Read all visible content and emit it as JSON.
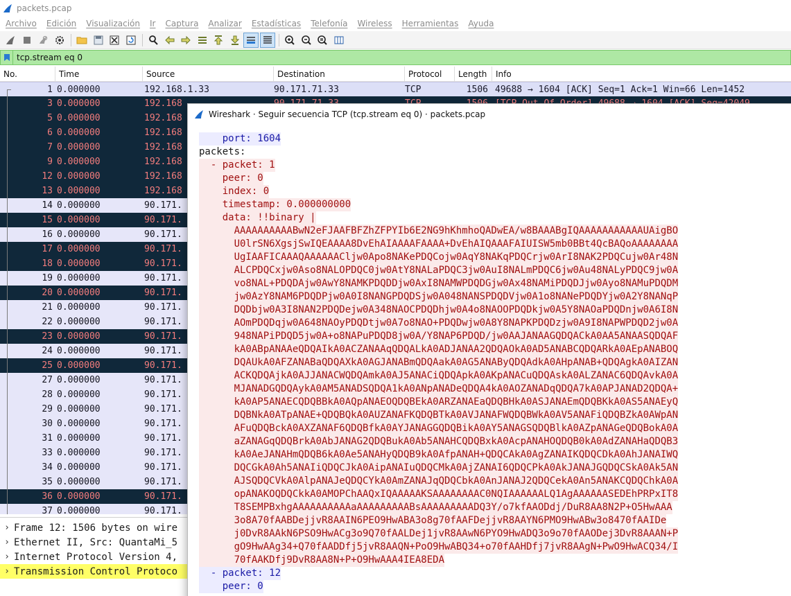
{
  "window": {
    "title": "packets.pcap"
  },
  "menu": [
    "Archivo",
    "Edición",
    "Visualización",
    "Ir",
    "Captura",
    "Analizar",
    "Estadísticas",
    "Telefonía",
    "Wireless",
    "Herramientas",
    "Ayuda"
  ],
  "toolbar": {
    "icons": [
      "shark-fin-start-icon",
      "stop-icon",
      "restart-icon",
      "options-gear-icon",
      "open-folder-icon",
      "save-file-icon",
      "close-file-icon",
      "reload-icon",
      "find-icon",
      "back-arrow-icon",
      "forward-arrow-icon",
      "go-to-packet-icon",
      "first-packet-icon",
      "last-packet-icon",
      "autoscroll-icon",
      "colorize-icon",
      "zoom-in-icon",
      "zoom-out-icon",
      "zoom-normal-icon",
      "resize-columns-icon"
    ]
  },
  "filter": {
    "value": "tcp.stream eq 0",
    "bg_color": "#aee8a4"
  },
  "packet_list": {
    "columns": [
      "No.",
      "Time",
      "Source",
      "Destination",
      "Protocol",
      "Length",
      "Info"
    ],
    "rows": [
      {
        "no": "1",
        "time": "0.000000",
        "src": "192.168.1.33",
        "dst": "90.171.71.33",
        "proto": "TCP",
        "len": "1506",
        "info": "49688 → 1604 [ACK] Seq=1 Ack=1 Win=66 Len=1452",
        "style": "selected"
      },
      {
        "no": "3",
        "time": "0.000000",
        "src": "192.168",
        "dst": "90.171.71.33",
        "proto": "TCP",
        "len": "1506",
        "info": "[TCP Out-Of-Order] 49688 → 1604 [ACK] Seq=42049",
        "style": "dark"
      },
      {
        "no": "5",
        "time": "0.000000",
        "src": "192.168",
        "dst": "",
        "proto": "",
        "len": "",
        "info": "",
        "style": "dark"
      },
      {
        "no": "6",
        "time": "0.000000",
        "src": "192.168",
        "dst": "",
        "proto": "",
        "len": "",
        "info": "",
        "style": "dark"
      },
      {
        "no": "7",
        "time": "0.000000",
        "src": "192.168",
        "dst": "",
        "proto": "",
        "len": "",
        "info": "",
        "style": "dark"
      },
      {
        "no": "9",
        "time": "0.000000",
        "src": "192.168",
        "dst": "",
        "proto": "",
        "len": "",
        "info": "",
        "style": "dark"
      },
      {
        "no": "12",
        "time": "0.000000",
        "src": "192.168",
        "dst": "",
        "proto": "",
        "len": "",
        "info": "",
        "style": "dark"
      },
      {
        "no": "13",
        "time": "0.000000",
        "src": "192.168",
        "dst": "",
        "proto": "",
        "len": "",
        "info": "",
        "style": "dark"
      },
      {
        "no": "14",
        "time": "0.000000",
        "src": "90.171.",
        "dst": "",
        "proto": "",
        "len": "",
        "info": "",
        "style": "light"
      },
      {
        "no": "15",
        "time": "0.000000",
        "src": "90.171.",
        "dst": "",
        "proto": "",
        "len": "",
        "info": "",
        "style": "dark"
      },
      {
        "no": "16",
        "time": "0.000000",
        "src": "90.171.",
        "dst": "",
        "proto": "",
        "len": "",
        "info": "",
        "style": "light"
      },
      {
        "no": "17",
        "time": "0.000000",
        "src": "90.171.",
        "dst": "",
        "proto": "",
        "len": "",
        "info": "",
        "style": "dark"
      },
      {
        "no": "18",
        "time": "0.000000",
        "src": "90.171.",
        "dst": "",
        "proto": "",
        "len": "",
        "info": "",
        "style": "dark"
      },
      {
        "no": "19",
        "time": "0.000000",
        "src": "90.171.",
        "dst": "",
        "proto": "",
        "len": "",
        "info": "",
        "style": "light"
      },
      {
        "no": "20",
        "time": "0.000000",
        "src": "90.171.",
        "dst": "",
        "proto": "",
        "len": "",
        "info": "",
        "style": "dark"
      },
      {
        "no": "21",
        "time": "0.000000",
        "src": "90.171.",
        "dst": "",
        "proto": "",
        "len": "",
        "info": "",
        "style": "light"
      },
      {
        "no": "22",
        "time": "0.000000",
        "src": "90.171.",
        "dst": "",
        "proto": "",
        "len": "",
        "info": "",
        "style": "light"
      },
      {
        "no": "23",
        "time": "0.000000",
        "src": "90.171.",
        "dst": "",
        "proto": "",
        "len": "",
        "info": "",
        "style": "dark"
      },
      {
        "no": "24",
        "time": "0.000000",
        "src": "90.171.",
        "dst": "",
        "proto": "",
        "len": "",
        "info": "",
        "style": "light"
      },
      {
        "no": "25",
        "time": "0.000000",
        "src": "90.171.",
        "dst": "",
        "proto": "",
        "len": "",
        "info": "",
        "style": "dark"
      },
      {
        "no": "27",
        "time": "0.000000",
        "src": "90.171.",
        "dst": "",
        "proto": "",
        "len": "",
        "info": "",
        "style": "light"
      },
      {
        "no": "28",
        "time": "0.000000",
        "src": "90.171.",
        "dst": "",
        "proto": "",
        "len": "",
        "info": "",
        "style": "light"
      },
      {
        "no": "29",
        "time": "0.000000",
        "src": "90.171.",
        "dst": "",
        "proto": "",
        "len": "",
        "info": "",
        "style": "light"
      },
      {
        "no": "30",
        "time": "0.000000",
        "src": "90.171.",
        "dst": "",
        "proto": "",
        "len": "",
        "info": "",
        "style": "light"
      },
      {
        "no": "31",
        "time": "0.000000",
        "src": "90.171.",
        "dst": "",
        "proto": "",
        "len": "",
        "info": "",
        "style": "light"
      },
      {
        "no": "33",
        "time": "0.000000",
        "src": "90.171.",
        "dst": "",
        "proto": "",
        "len": "",
        "info": "",
        "style": "light"
      },
      {
        "no": "34",
        "time": "0.000000",
        "src": "90.171.",
        "dst": "",
        "proto": "",
        "len": "",
        "info": "",
        "style": "light"
      },
      {
        "no": "35",
        "time": "0.000000",
        "src": "90.171.",
        "dst": "",
        "proto": "",
        "len": "",
        "info": "",
        "style": "light"
      },
      {
        "no": "36",
        "time": "0.000000",
        "src": "90.171.",
        "dst": "",
        "proto": "",
        "len": "",
        "info": "",
        "style": "dark"
      },
      {
        "no": "37",
        "time": "0.000000",
        "src": "90.171.",
        "dst": "",
        "proto": "",
        "len": "",
        "info": "",
        "style": "light"
      }
    ],
    "colors": {
      "light": "#e6e6f9",
      "dark": "#10283a",
      "dark_text": "#f47d7d"
    }
  },
  "details": [
    {
      "text": "Frame 12: 1506 bytes on wire",
      "highlight": false
    },
    {
      "text": "Ethernet II, Src: QuantaMi_5",
      "highlight": false
    },
    {
      "text": "Internet Protocol Version 4,",
      "highlight": false
    },
    {
      "text": "Transmission Control Protoco",
      "highlight": true
    }
  ],
  "dialog": {
    "title": "Wireshark · Seguir secuencia TCP (tcp.stream eq 0) · packets.pcap",
    "lines": [
      {
        "text": "    port: 1604",
        "kind": "b"
      },
      {
        "text": "packets:",
        "kind": "p"
      },
      {
        "text": "  - packet: 1",
        "kind": "r"
      },
      {
        "text": "    peer: 0",
        "kind": "r"
      },
      {
        "text": "    index: 0",
        "kind": "r"
      },
      {
        "text": "    timestamp: 0.000000000",
        "kind": "r"
      },
      {
        "text": "    data: !!binary |",
        "kind": "r"
      },
      {
        "text": "      AAAAAAAAAABwN2eFJAAFBFZhZFPYIb6E2NG9hKhmhoQADwEA/w8BAAABgIQAAAAAAAAAAAUAigBO",
        "kind": "r"
      },
      {
        "text": "      U0lrSN6XgsjSwIQEAAAA8DvEhAIAAAAFAAAA+DvEhAIQAAAFAIUISW5mb0BBt4QcBAQoAAAAAAAA",
        "kind": "r"
      },
      {
        "text": "      UgIAAFICAAAQAAAAAACljw0Apo8NAKePDQCojw0AqY8NAKqPDQCrjw0ArI8NAK2PDQCujw0Ar48N",
        "kind": "r"
      },
      {
        "text": "      ALCPDQCxjw0Aso8NALOPDQC0jw0AtY8NALaPDQC3jw0AuI8NALmPDQC6jw0Au48NALyPDQC9jw0A",
        "kind": "r"
      },
      {
        "text": "      vo8NAL+PDQDAjw0AwY8NAMKPDQDDjw0AxI8NAMWPDQDGjw0Ax48NAMiPDQDJjw0Ayo8NAMuPDQDM",
        "kind": "r"
      },
      {
        "text": "      jw0AzY8NAM6PDQDPjw0A0I8NANGPDQDSjw0A048NANSPDQDVjw0A1o8NANePDQDYjw0A2Y8NANqP",
        "kind": "r"
      },
      {
        "text": "      DQDbjw0A3I8NAN2PDQDejw0A348NAOCPDQDhjw0A4o8NAOOPDQDkjw0A5Y8NAOaPDQDnjw0A6I8N",
        "kind": "r"
      },
      {
        "text": "      AOmPDQDqjw0A648NAOyPDQDtjw0A7o8NAO+PDQDwjw0A8Y8NAPKPDQDzjw0A9I8NAPWPDQD2jw0A",
        "kind": "r"
      },
      {
        "text": "      948NAPiPDQD5jw0A+o8NAPuPDQD8jw0A/Y8NAP6PDQD/jw0AAJANAAGQDQACkA0AA5ANAASQDQAF",
        "kind": "r"
      },
      {
        "text": "      kA0ABpANAAeQDQAIkA0ACZANAAqQDQALkA0ADJANAA2QDQAOkA0AD5ANABCQDQARkA0AEpANABOQ",
        "kind": "r"
      },
      {
        "text": "      DQAUkA0AFZANABaQDQAXkA0AGJANABmQDQAakA0AG5ANAByQDQAdkA0AHpANAB+QDQAgkA0AIZAN",
        "kind": "r"
      },
      {
        "text": "      ACKQDQAjkA0AJJANACWQDQAmkA0AJ5ANACiQDQApkA0AKpANACuQDQAskA0ALZANAC6QDQAvkA0A",
        "kind": "r"
      },
      {
        "text": "      MJANADGQDQAykA0AM5ANADSQDQA1kA0ANpANADeQDQA4kA0AOZANADqQDQA7kA0APJANAD2QDQA+",
        "kind": "r"
      },
      {
        "text": "      kA0AP5ANAECQDQBBkA0AQpANAEOQDQBEkA0ARZANAEaQDQBHkA0ASJANAEmQDQBKkA0AS5ANAEyQ",
        "kind": "r"
      },
      {
        "text": "      DQBNkA0ATpANAE+QDQBQkA0AUZANAFKQDQBTkA0AVJANAFWQDQBWkA0AV5ANAFiQDQBZkA0AWpAN",
        "kind": "r"
      },
      {
        "text": "      AFuQDQBckA0AXZANAF6QDQBfkA0AYJANAGGQDQBikA0AY5ANAGSQDQBlkA0AZpANAGeQDQBokA0A",
        "kind": "r"
      },
      {
        "text": "      aZANAGqQDQBrkA0AbJANAG2QDQBukA0Ab5ANAHCQDQBxkA0AcpANAHOQDQB0kA0AdZANAHaQDQB3",
        "kind": "r"
      },
      {
        "text": "      kA0AeJANAHmQDQB6kA0Ae5ANAHyQDQB9kA0AfpANAH+QDQCAkA0AgZANAIKQDQCDkA0AhJANAIWQ",
        "kind": "r"
      },
      {
        "text": "      DQCGkA0Ah5ANAIiQDQCJkA0AipANAIuQDQCMkA0AjZANAI6QDQCPkA0AkJANAJGQDQCSkA0Ak5AN",
        "kind": "r"
      },
      {
        "text": "      AJSQDQCVkA0AlpANAJeQDQCYkA0AmZANAJqQDQCbkA0AnJANAJ2QDQCekA0An5ANAKCQDQChkA0A",
        "kind": "r"
      },
      {
        "text": "      opANAKOQDQCkkA0AMOPChAAQxIQAAAAAKSAAAAAAAAC0NQIAAAAAALQ1AgAAAAAASEDEhPRPxIT8",
        "kind": "r"
      },
      {
        "text": "      T8SEMPBxhgAAAAAAAAAAaAAAAAAAAABsAAAAAAAAADQ3Y/o7kfAAODdj/DuR8AA8N2P+O5HwAAA",
        "kind": "r"
      },
      {
        "text": "      3o8A70fAABDejjvR8AAIN6PEO9HwABA3o8g70fAAFDejjvR8AAYN6PMO9HwABw3o8470fAAIDe",
        "kind": "r"
      },
      {
        "text": "      j0DvR8AAkN6PSO9HwACg3o9Q70fAALDej1jvR8AAwN6PYO9HwADQ3o9o70fAAODej3DvR8AAAN+P",
        "kind": "r"
      },
      {
        "text": "      gO9HwAAg34+Q70fAADDfj5jvR8AAQN+PoO9HwABQ34+o70fAAHDfj7jvR8AAgN+PwO9HwACQ34/I",
        "kind": "r"
      },
      {
        "text": "      70fAAKDfj9DvR8AA8N+P+O9HwAAA4IEA8EDA",
        "kind": "r"
      },
      {
        "text": "  - packet: 12",
        "kind": "b"
      },
      {
        "text": "    peer: 0",
        "kind": "b"
      }
    ],
    "colors": {
      "client_text": "#a01010",
      "client_bg": "#fbeaea",
      "server_text": "#1a1aa6",
      "server_bg": "#ececff"
    }
  }
}
